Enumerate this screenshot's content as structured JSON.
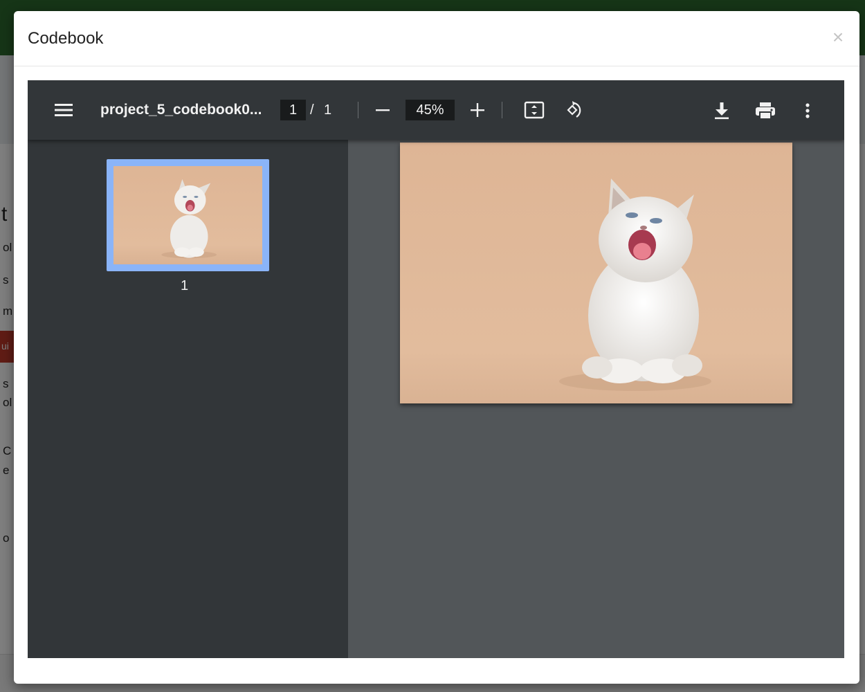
{
  "modal": {
    "title": "Codebook",
    "close_label": "×"
  },
  "viewer": {
    "file_name": "project_5_codebook0...",
    "current_page": "1",
    "page_separator": "/",
    "total_pages": "1",
    "zoom": "45%",
    "thumbnail_label": "1",
    "colors": {
      "toolbar": "#323639",
      "page_area": "#525659",
      "thumbnail_highlight": "#8ab4f8",
      "page_background": "#e0b99a"
    },
    "icons": [
      "menu-icon",
      "zoom-out-icon",
      "zoom-in-icon",
      "fit-page-icon",
      "rotate-icon",
      "download-icon",
      "print-icon",
      "more-vert-icon"
    ]
  },
  "document_image": {
    "subject": "kitten"
  }
}
